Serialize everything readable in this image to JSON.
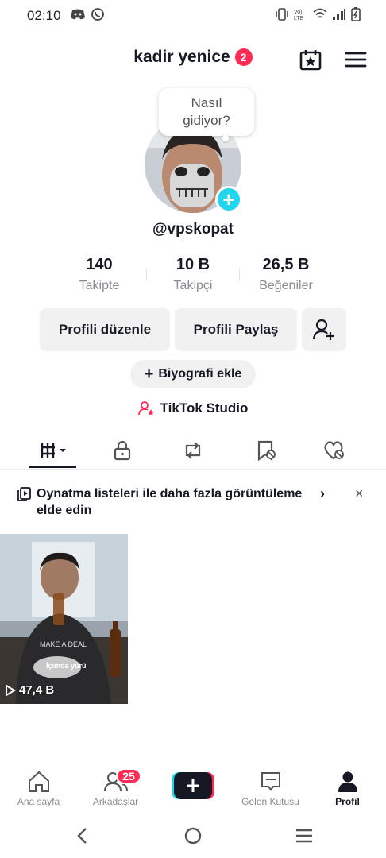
{
  "status_bar": {
    "time": "02:10"
  },
  "header": {
    "title": "kadir yenice",
    "notification_count": "2"
  },
  "bubble": {
    "line1": "Nasıl",
    "line2": "gidiyor?"
  },
  "profile": {
    "username": "@vpskopat"
  },
  "stats": [
    {
      "value": "140",
      "label": "Takipte"
    },
    {
      "value": "10 B",
      "label": "Takipçi"
    },
    {
      "value": "26,5 B",
      "label": "Beğeniler"
    }
  ],
  "buttons": {
    "edit_profile": "Profili düzenle",
    "share_profile": "Profili Paylaş",
    "add_bio": "Biyografi ekle",
    "studio": "TikTok Studio"
  },
  "promo": {
    "text": "Oynatma listeleri ile daha fazla görüntüleme elde edin",
    "chevron": "›",
    "close": "×"
  },
  "videos": [
    {
      "views": "47,4 B",
      "caption": "İçimde yürü"
    }
  ],
  "bottom_nav": {
    "home": "Ana sayfa",
    "friends": "Arkadaşlar",
    "friends_badge": "25",
    "inbox": "Gelen Kutusu",
    "profile": "Profil"
  },
  "colors": {
    "accent": "#fe2c55",
    "cyan": "#20d5ec",
    "text": "#161823",
    "muted": "#8a8b91"
  }
}
